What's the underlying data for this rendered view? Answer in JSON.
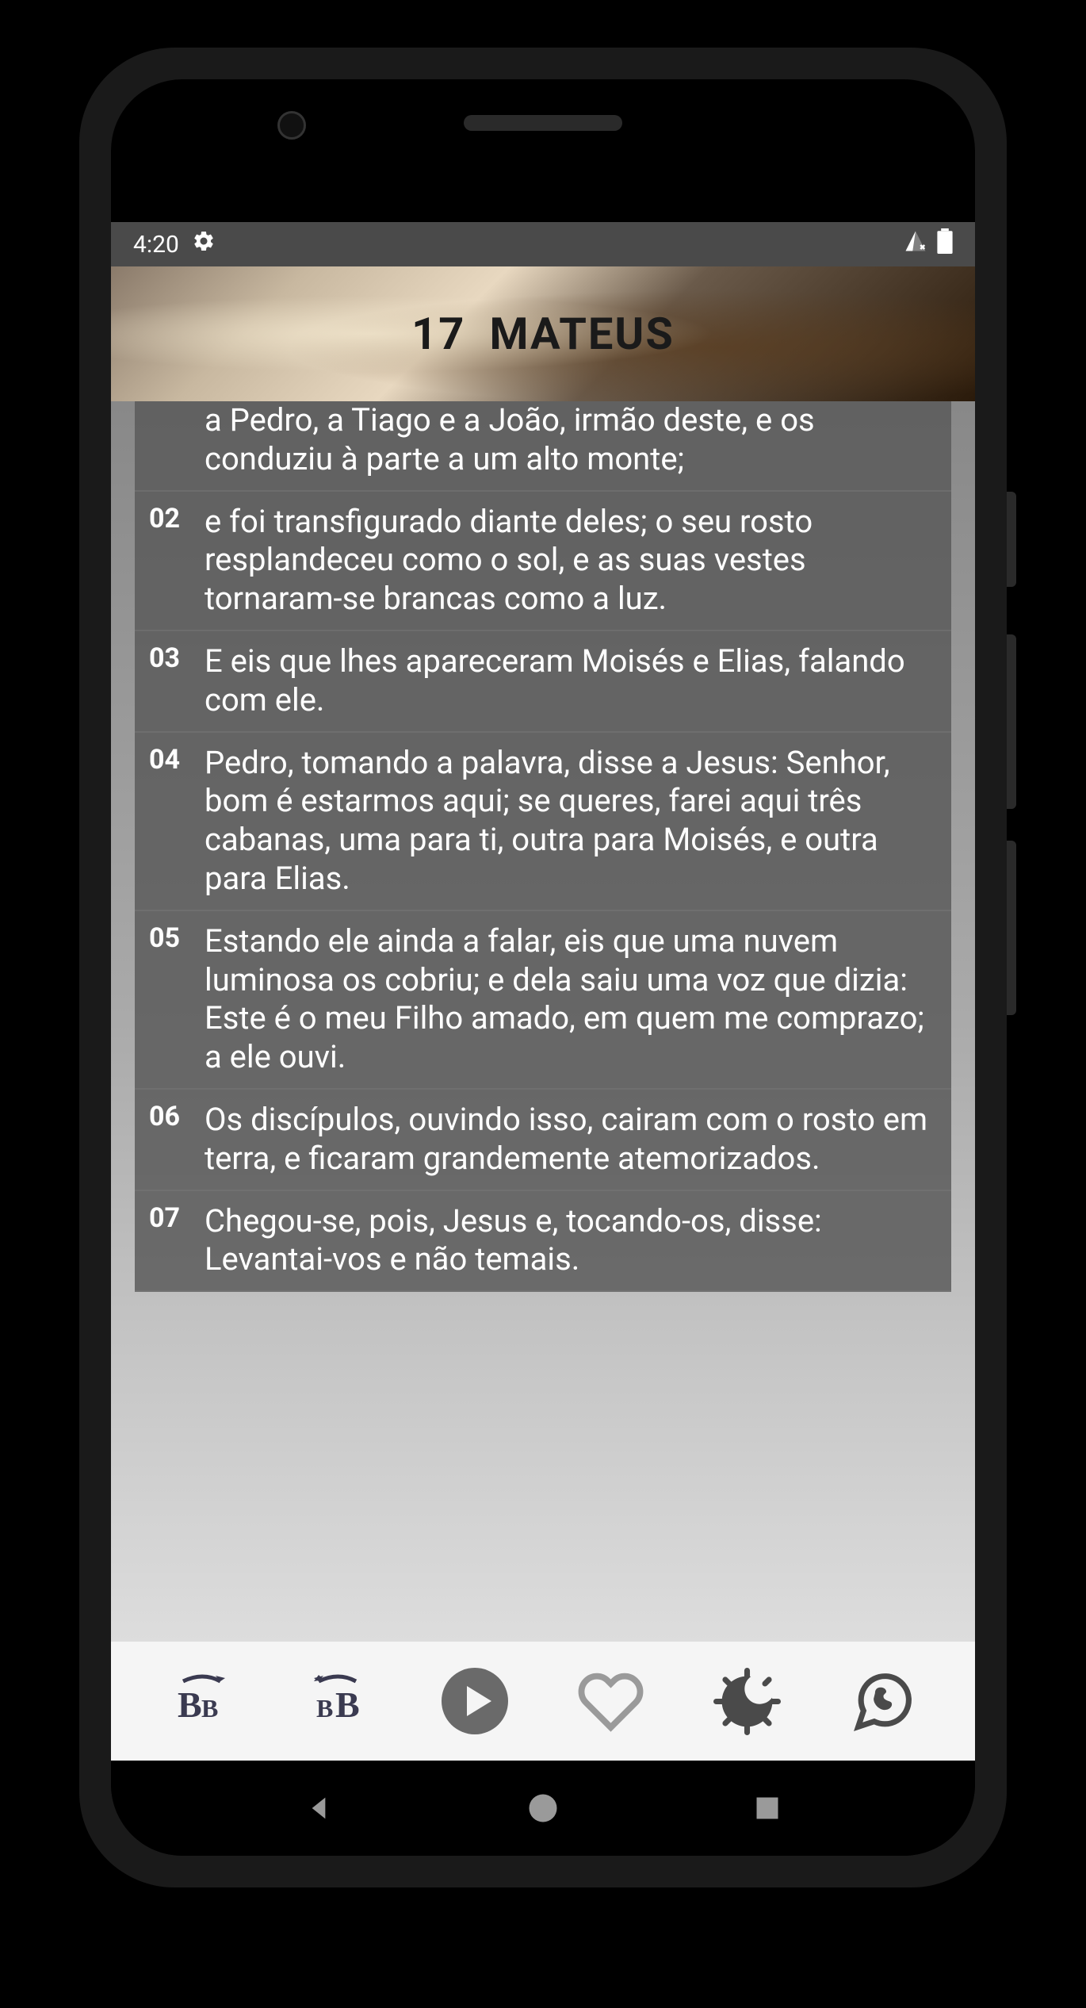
{
  "status": {
    "time": "4:20"
  },
  "header": {
    "chapter": "17",
    "book": "MATEUS"
  },
  "verses": [
    {
      "num": "",
      "text": "a Pedro, a Tiago e a João, irmão deste, e os conduziu à parte a um alto monte;"
    },
    {
      "num": "02",
      "text": "e foi transfigurado diante deles; o seu rosto resplandeceu como o sol, e as suas vestes tornaram-se brancas como a luz."
    },
    {
      "num": "03",
      "text": "E eis que lhes apareceram Moisés e Elias, falando com ele."
    },
    {
      "num": "04",
      "text": "Pedro, tomando a palavra, disse a Jesus: Senhor, bom é estarmos aqui; se queres, farei aqui três cabanas, uma para ti, outra para Moisés, e outra para Elias."
    },
    {
      "num": "05",
      "text": "Estando ele ainda a falar, eis que uma nuvem luminosa os cobriu; e dela saiu uma voz que dizia: Este é o meu Filho amado, em quem me comprazo; a ele ouvi."
    },
    {
      "num": "06",
      "text": "Os discípulos, ouvindo isso, cairam com o rosto em terra, e ficaram grandemente atemorizados."
    },
    {
      "num": "07",
      "text": "Chegou-se, pois, Jesus e, tocando-os, disse: Levantai-vos e não temais."
    }
  ]
}
